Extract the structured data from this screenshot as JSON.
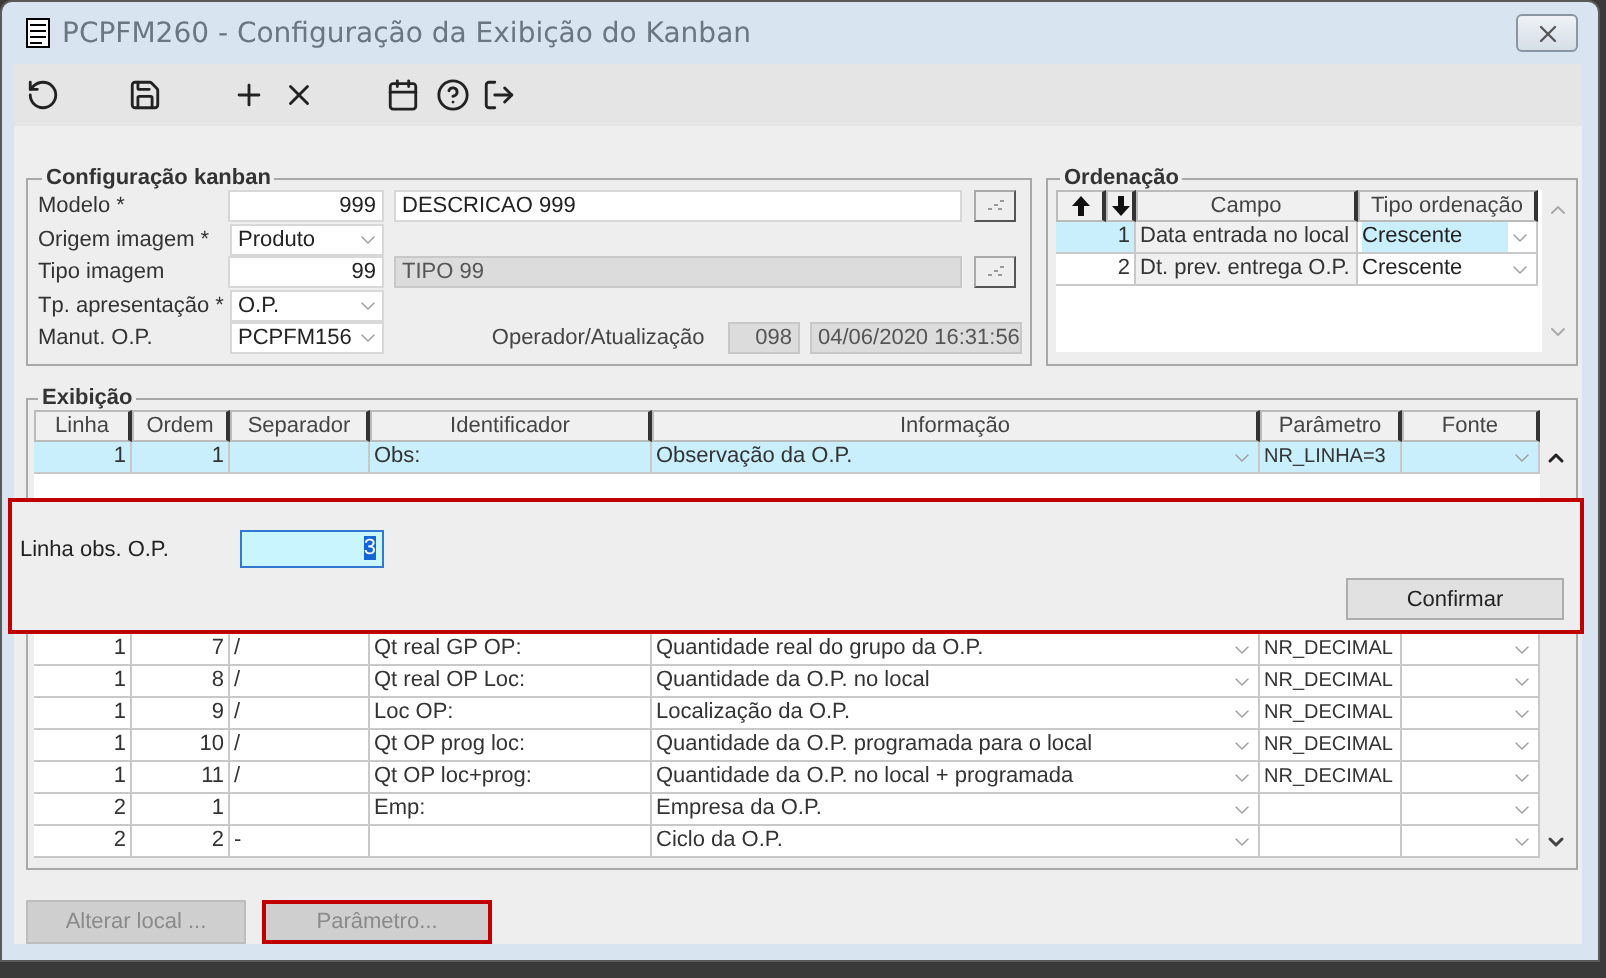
{
  "window": {
    "title": "PCPFM260 - Configuração da Exibição do Kanban"
  },
  "config": {
    "title": "Configuração kanban",
    "fields": [
      {
        "kind": "code",
        "label": "Modelo *",
        "value": "999",
        "description": "DESCRICAO 999",
        "description_disabled": false
      },
      {
        "kind": "select",
        "label": "Origem imagem *",
        "value": "Produto"
      },
      {
        "kind": "code",
        "label": "Tipo imagem",
        "value": "99",
        "description": "TIPO 99",
        "description_disabled": true
      },
      {
        "kind": "select",
        "label": "Tp. apresentação *",
        "value": "O.P."
      },
      {
        "kind": "select",
        "label": "Manut. O.P.",
        "value": "PCPFM156"
      }
    ],
    "operator": {
      "label": "Operador/Atualização",
      "code": "098",
      "timestamp": "04/06/2020 16:31:56"
    }
  },
  "ordenacao": {
    "title": "Ordenação",
    "columns": [
      "Campo",
      "Tipo ordenação"
    ],
    "rows": [
      {
        "number": "1",
        "field": "Data entrada no local",
        "order": "Crescente",
        "selected": true
      },
      {
        "number": "2",
        "field": "Dt. prev. entrega O.P.",
        "order": "Crescente",
        "selected": false
      }
    ]
  },
  "exibicao": {
    "title": "Exibição",
    "columns": [
      "Linha",
      "Ordem",
      "Separador",
      "Identificador",
      "Informação",
      "Parâmetro",
      "Fonte"
    ],
    "rows_top": [
      {
        "linha": "1",
        "ordem": "1",
        "identificador": "Obs:",
        "informacao": "Observação da O.P.",
        "parametro": "NR_LINHA=3",
        "selected": true
      }
    ],
    "rows_bottom": [
      {
        "linha": "1",
        "ordem": "7",
        "separador": "/",
        "identificador": "Qt real GP OP:",
        "informacao": "Quantidade real do grupo da O.P.",
        "parametro": "NR_DECIMAL",
        "selected": false
      },
      {
        "linha": "1",
        "ordem": "8",
        "separador": "/",
        "identificador": "Qt real OP Loc:",
        "informacao": "Quantidade da O.P. no local",
        "parametro": "NR_DECIMAL",
        "selected": false
      },
      {
        "linha": "1",
        "ordem": "9",
        "separador": "/",
        "identificador": "Loc OP:",
        "informacao": "Localização da O.P.",
        "parametro": "NR_DECIMAL",
        "selected": false
      },
      {
        "linha": "1",
        "ordem": "10",
        "separador": "/",
        "identificador": "Qt OP prog loc:",
        "informacao": "Quantidade da O.P. programada para o local",
        "parametro": "NR_DECIMAL",
        "selected": false
      },
      {
        "linha": "1",
        "ordem": "11",
        "separador": "/",
        "identificador": "Qt OP loc+prog:",
        "informacao": "Quantidade da O.P. no local + programada",
        "parametro": "NR_DECIMAL",
        "selected": false
      },
      {
        "linha": "2",
        "ordem": "1",
        "identificador": "Emp:",
        "informacao": "Empresa da O.P.",
        "selected": false
      },
      {
        "linha": "2",
        "ordem": "2",
        "separador": "-",
        "informacao": "Ciclo da O.P.",
        "selected": false
      }
    ]
  },
  "dialog": {
    "label": "Linha obs. O.P.",
    "value": "3",
    "text_selected": true,
    "button": "Confirmar"
  },
  "buttons": [
    {
      "label": "Alterar local ...",
      "disabled": true,
      "highlighted": false
    },
    {
      "label": "Parâmetro...",
      "disabled": true,
      "highlighted": true
    }
  ]
}
